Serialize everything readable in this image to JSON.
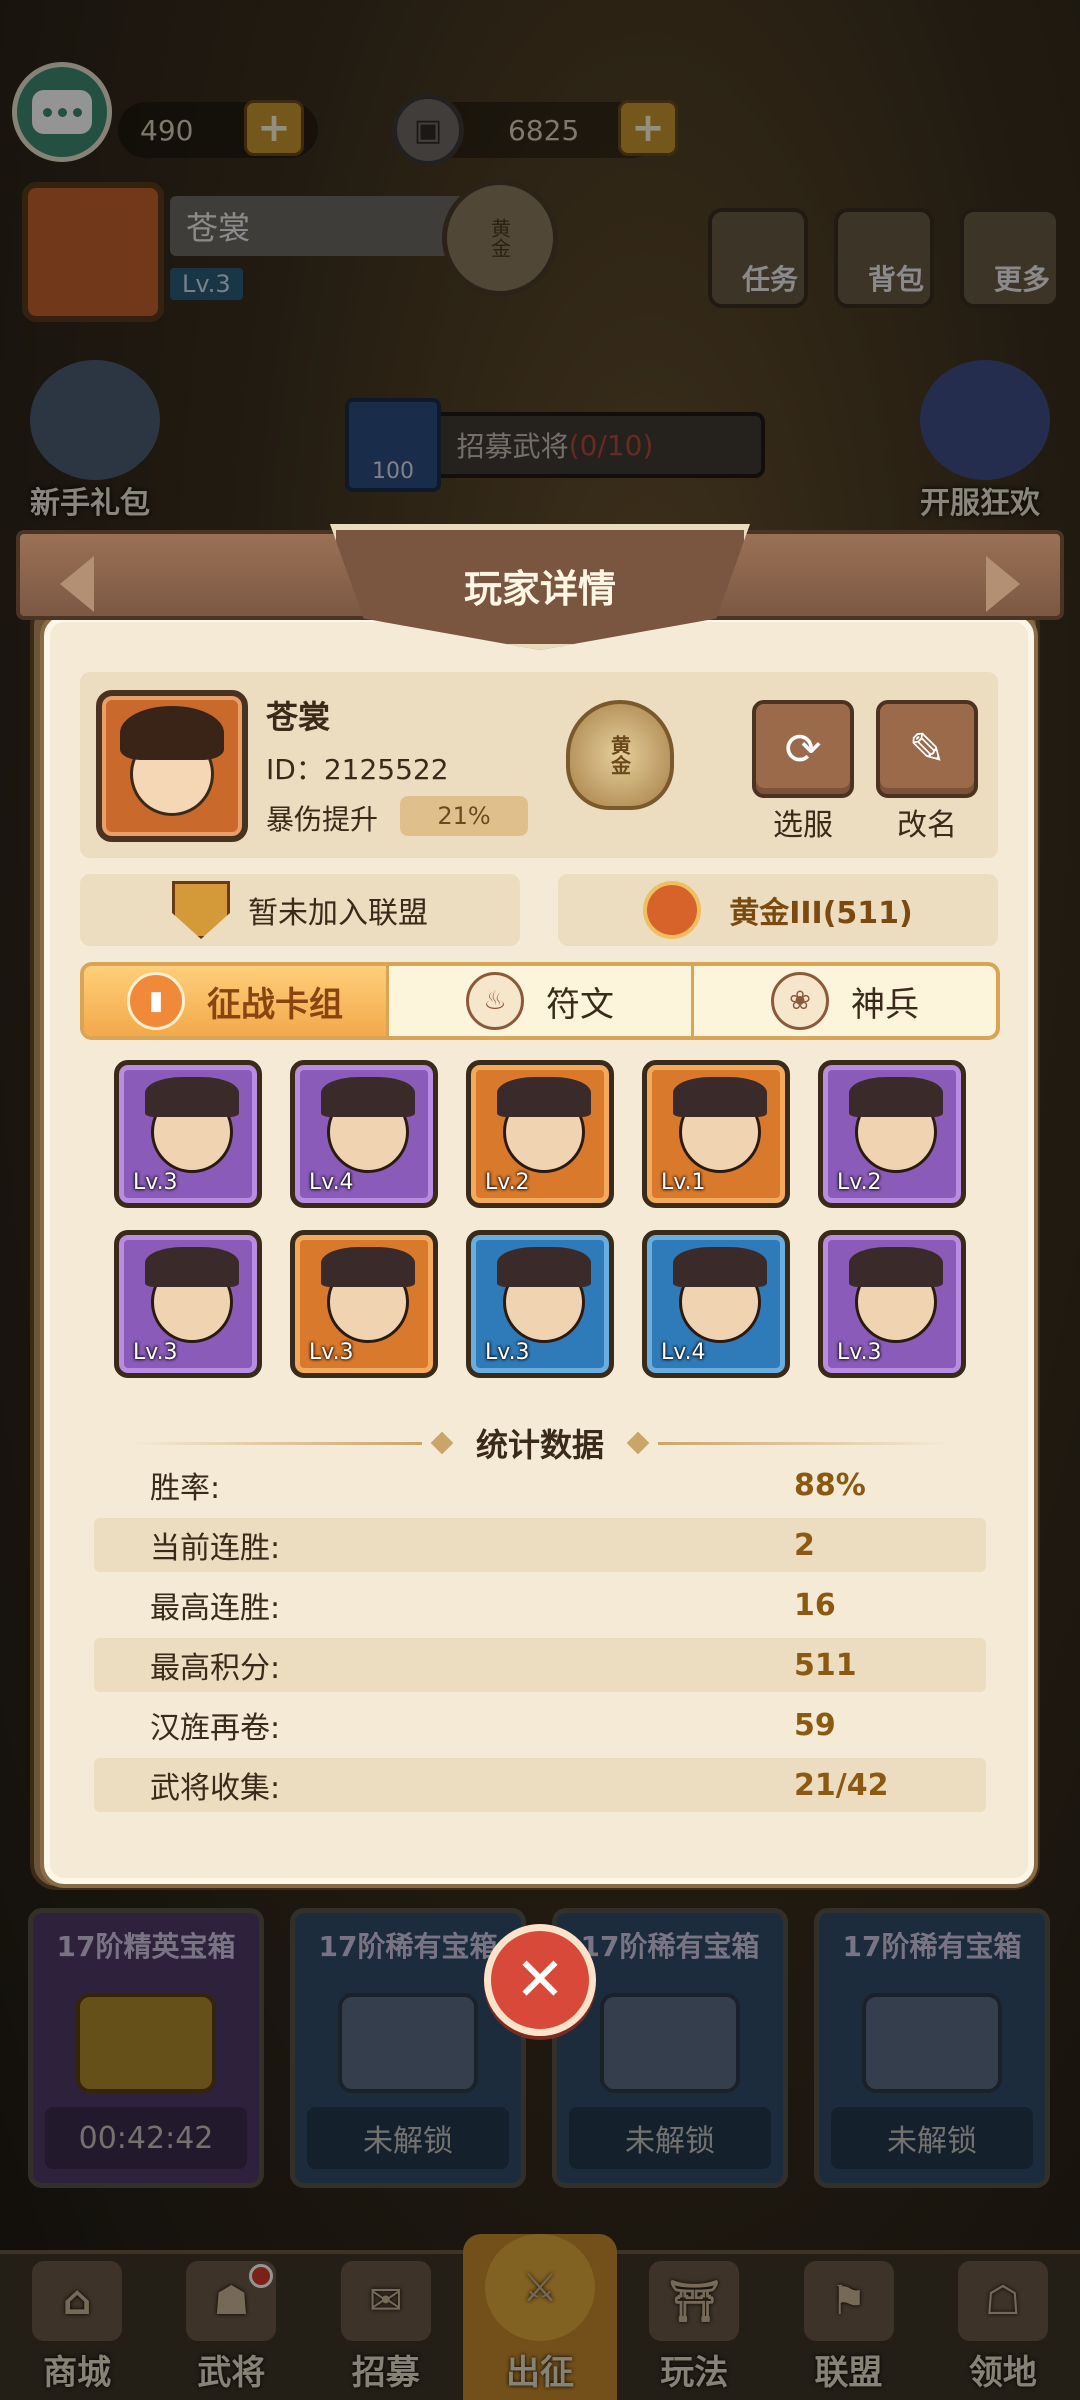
{
  "top_bar": {
    "gems": "490",
    "coins": "6825",
    "player_name": "苍裳",
    "player_level": "Lv.3",
    "rank_badge": "黄金",
    "buttons": {
      "tasks": "任务",
      "backpack": "背包",
      "more": "更多"
    }
  },
  "side": {
    "newbie_gift": "新手礼包",
    "server_carnival": "开服狂欢"
  },
  "recruit": {
    "cost": "100",
    "label": "招募武将",
    "progress": "(0/10)"
  },
  "chests": [
    {
      "title": "17阶精英宝箱",
      "status": "00:42:42",
      "tier": "elite"
    },
    {
      "title": "17阶稀有宝箱",
      "status": "未解锁",
      "tier": "rare"
    },
    {
      "title": "17阶稀有宝箱",
      "status": "未解锁",
      "tier": "rare"
    },
    {
      "title": "17阶稀有宝箱",
      "status": "未解锁",
      "tier": "rare"
    }
  ],
  "bottom_nav": [
    {
      "label": "商城",
      "icon": "shop-icon"
    },
    {
      "label": "武将",
      "icon": "general-icon",
      "badge": true
    },
    {
      "label": "招募",
      "icon": "recruit-icon"
    },
    {
      "label": "出征",
      "icon": "battle-icon",
      "active": true
    },
    {
      "label": "玩法",
      "icon": "play-icon"
    },
    {
      "label": "联盟",
      "icon": "alliance-icon"
    },
    {
      "label": "领地",
      "icon": "territory-icon"
    }
  ],
  "modal": {
    "title": "玩家详情",
    "profile": {
      "name": "苍裳",
      "id_text": "ID：2125522",
      "crit_label": "暴伤提升",
      "crit_value": "21%",
      "rank_badge": "黄金"
    },
    "actions": {
      "select_server": "选服",
      "rename": "改名"
    },
    "alliance": "暂未加入联盟",
    "rank": "黄金III(511)",
    "tabs": [
      {
        "label": "征战卡组",
        "icon": "card-icon",
        "active": true
      },
      {
        "label": "符文",
        "icon": "rune-icon",
        "active": false
      },
      {
        "label": "神兵",
        "icon": "weapon-icon",
        "active": false
      }
    ],
    "deck": [
      {
        "level": "Lv.3",
        "rarity": "purple"
      },
      {
        "level": "Lv.4",
        "rarity": "purple"
      },
      {
        "level": "Lv.2",
        "rarity": "orange"
      },
      {
        "level": "Lv.1",
        "rarity": "orange"
      },
      {
        "level": "Lv.2",
        "rarity": "purple"
      },
      {
        "level": "Lv.3",
        "rarity": "purple"
      },
      {
        "level": "Lv.3",
        "rarity": "orange"
      },
      {
        "level": "Lv.3",
        "rarity": "blue"
      },
      {
        "level": "Lv.4",
        "rarity": "blue"
      },
      {
        "level": "Lv.3",
        "rarity": "purple"
      }
    ],
    "stats_title": "统计数据",
    "stats": [
      {
        "label": "胜率:",
        "value": "88%"
      },
      {
        "label": "当前连胜:",
        "value": "2"
      },
      {
        "label": "最高连胜:",
        "value": "16"
      },
      {
        "label": "最高积分:",
        "value": "511"
      },
      {
        "label": "汉旌再卷:",
        "value": "59"
      },
      {
        "label": "武将收集:",
        "value": "21/42"
      }
    ]
  },
  "colors": {
    "modal_bg": "#f4ead6",
    "panel_bg": "#ecdcc0",
    "accent_orange": "#f2a94a",
    "close_red": "#d9493a",
    "stat_value": "#8a5a12"
  }
}
